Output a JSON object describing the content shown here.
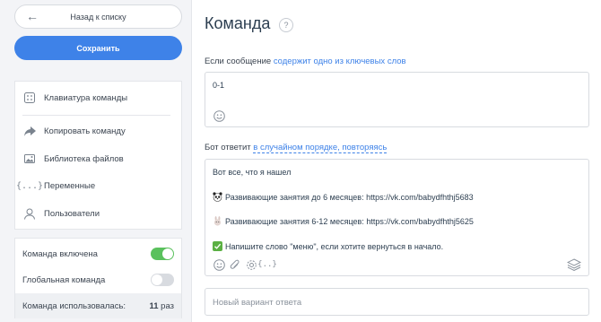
{
  "sidebar": {
    "back_label": "Назад к списку",
    "save_label": "Сохранить",
    "menu": [
      {
        "label": "Клавиатура команды",
        "icon": "keyboard-icon"
      },
      {
        "label": "Копировать команду",
        "icon": "share-icon"
      },
      {
        "label": "Библиотека файлов",
        "icon": "image-icon"
      },
      {
        "label": "Переменные",
        "icon": "braces-icon"
      },
      {
        "label": "Пользователи",
        "icon": "user-icon"
      }
    ],
    "settings": {
      "enabled_label": "Команда включена",
      "enabled": true,
      "global_label": "Глобальная команда",
      "global": false,
      "used_label": "Команда использовалась:",
      "used_count": "11",
      "used_unit": "раз"
    }
  },
  "main": {
    "title": "Команда",
    "help": "?",
    "trigger": {
      "prefix": "Если сообщение",
      "link": "содержит одно из ключевых слов",
      "value": "0-1"
    },
    "reply": {
      "prefix": "Бот ответит",
      "link": "в случайном порядке, повторяясь",
      "lines": [
        {
          "emoji": "",
          "text": "Вот все, что я нашел"
        },
        {
          "emoji": "panda",
          "text": "Развивающие занятия до 6 месяцев: https://vk.com/babydfhthj5683"
        },
        {
          "emoji": "rabbit",
          "text": "Развивающие занятия 6-12 месяцев: https://vk.com/babydfhthj5625"
        },
        {
          "emoji": "check",
          "text": "Напишите слово \"меню\", если хотите вернуться в начало."
        }
      ]
    },
    "new_variant_placeholder": "Новый вариант ответа"
  },
  "colors": {
    "accent": "#3e82e8",
    "toggle_on": "#5ac15d",
    "sidebar_bg": "#f3f4f7"
  }
}
